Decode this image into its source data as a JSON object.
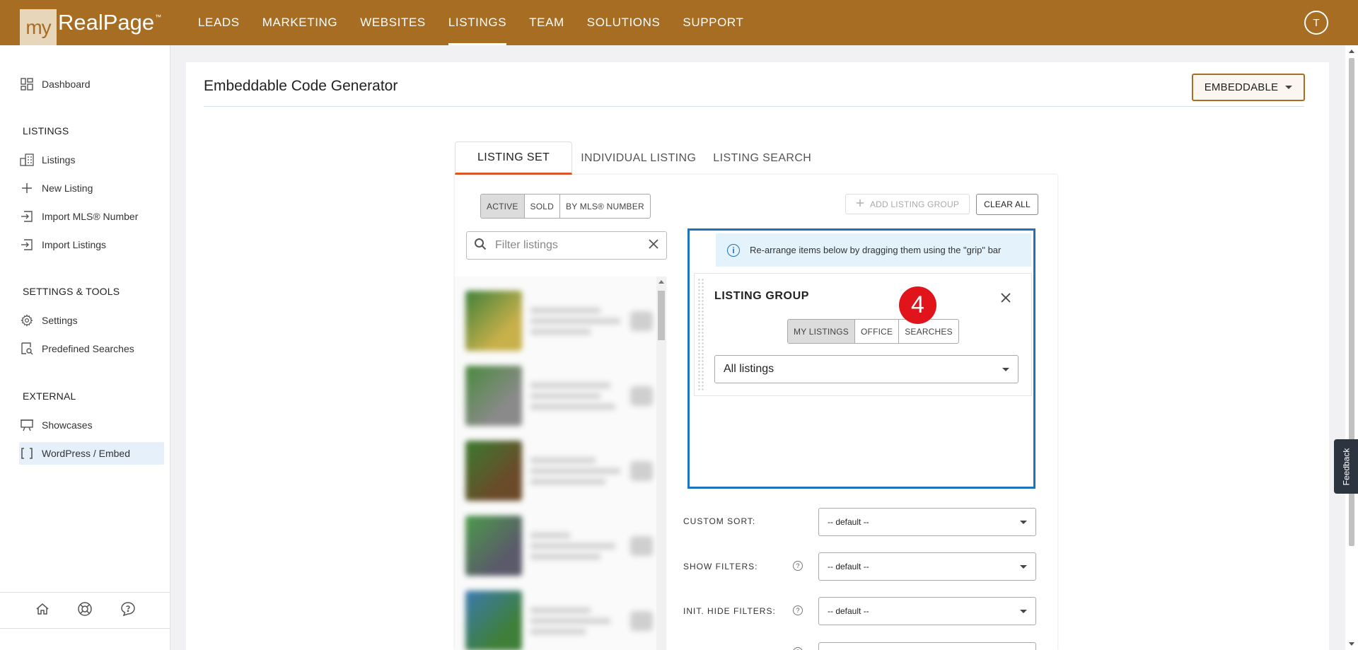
{
  "app": {
    "logo_my": "my",
    "logo_name": "RealPage",
    "logo_tm": "™",
    "avatar_initial": "T"
  },
  "topnav": [
    {
      "label": "LEADS"
    },
    {
      "label": "MARKETING"
    },
    {
      "label": "WEBSITES"
    },
    {
      "label": "LISTINGS",
      "active": true
    },
    {
      "label": "TEAM"
    },
    {
      "label": "SOLUTIONS"
    },
    {
      "label": "SUPPORT"
    }
  ],
  "sidebar": {
    "dashboard": {
      "label": "Dashboard",
      "icon": "dashboard-icon"
    },
    "listings_header": "LISTINGS",
    "listings_items": [
      {
        "label": "Listings",
        "icon": "buildings-icon"
      },
      {
        "label": "New Listing",
        "icon": "plus-icon"
      },
      {
        "label": "Import MLS® Number",
        "icon": "import-icon"
      },
      {
        "label": "Import Listings",
        "icon": "import-icon"
      }
    ],
    "settings_header": "SETTINGS & TOOLS",
    "settings_items": [
      {
        "label": "Settings",
        "icon": "gear-icon"
      },
      {
        "label": "Predefined Searches",
        "icon": "search-doc-icon"
      }
    ],
    "external_header": "EXTERNAL",
    "external_items": [
      {
        "label": "Showcases",
        "icon": "easel-icon"
      },
      {
        "label": "WordPress / Embed",
        "icon": "brackets-icon",
        "active": true
      }
    ],
    "footer_icons": [
      "home-icon",
      "lifebuoy-icon",
      "chat-help-icon"
    ]
  },
  "main": {
    "title": "Embeddable Code Generator",
    "mode_button": "EMBEDDABLE",
    "tabs": [
      {
        "label": "LISTING SET",
        "active": true
      },
      {
        "label": "INDIVIDUAL LISTING"
      },
      {
        "label": "LISTING SEARCH"
      }
    ],
    "status_filter": [
      "ACTIVE",
      "SOLD",
      "BY MLS® NUMBER"
    ],
    "status_active": "ACTIVE",
    "filter_placeholder": "Filter listings",
    "add_group_label": "ADD LISTING GROUP",
    "clear_all_label": "CLEAR ALL",
    "info_text": "Re-arrange items below by dragging them using the \"grip\" bar",
    "group": {
      "title": "LISTING GROUP",
      "source_options": [
        "MY LISTINGS",
        "OFFICE",
        "SEARCHES"
      ],
      "source_active": "MY LISTINGS",
      "selection": "All listings",
      "badge": "4"
    },
    "options": [
      {
        "label": "CUSTOM SORT:",
        "value": "-- default --",
        "help": false
      },
      {
        "label": "SHOW FILTERS:",
        "value": "-- default --",
        "help": true
      },
      {
        "label": "INIT. HIDE FILTERS:",
        "value": "-- default --",
        "help": true
      }
    ]
  },
  "feedback_label": "Feedback",
  "colors": {
    "brand": "#a66d23",
    "accent_blue": "#1e73be",
    "tab_underline": "#e05a2a",
    "badge_red": "#e0141a"
  }
}
